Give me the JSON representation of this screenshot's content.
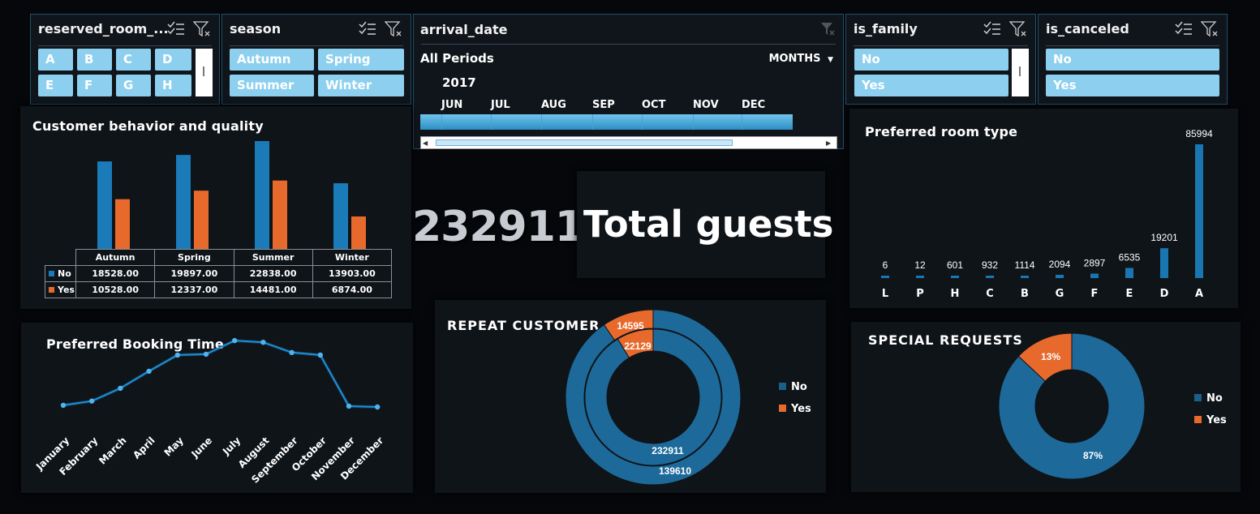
{
  "colors": {
    "no": "#1a7bb8",
    "yes": "#e8692c",
    "slicer_btn": "#8ccfee",
    "line": "#1e8fd6"
  },
  "slicers": {
    "reserved_room": {
      "title": "reserved_room_...",
      "options": [
        "A",
        "B",
        "C",
        "D",
        "E",
        "F",
        "G",
        "H"
      ]
    },
    "season": {
      "title": "season",
      "options": [
        "Autumn",
        "Spring",
        "Summer",
        "Winter"
      ]
    },
    "is_family": {
      "title": "is_family",
      "options": [
        "No",
        "Yes"
      ]
    },
    "is_canceled": {
      "title": "is_canceled",
      "options": [
        "No",
        "Yes"
      ]
    }
  },
  "timeline": {
    "title": "arrival_date",
    "period": "All Periods",
    "granularity": "MONTHS",
    "year": "2017",
    "months": [
      "JUN",
      "JUL",
      "AUG",
      "SEP",
      "OCT",
      "NOV",
      "DEC"
    ]
  },
  "kpi": {
    "value": "232911",
    "label": "Total guests"
  },
  "chart_data": [
    {
      "type": "bar",
      "title": "Customer behavior and quality",
      "categories": [
        "Autumn",
        "Spring",
        "Summer",
        "Winter"
      ],
      "series": [
        {
          "name": "No",
          "values": [
            18528,
            19897,
            22838,
            13903
          ]
        },
        {
          "name": "Yes",
          "values": [
            10528,
            12337,
            14481,
            6874
          ]
        }
      ],
      "table": {
        "No": [
          "18528.00",
          "19897.00",
          "22838.00",
          "13903.00"
        ],
        "Yes": [
          "10528.00",
          "12337.00",
          "14481.00",
          "6874.00"
        ]
      }
    },
    {
      "type": "bar",
      "title": "Preferred room type",
      "categories": [
        "L",
        "P",
        "H",
        "C",
        "B",
        "G",
        "F",
        "E",
        "D",
        "A"
      ],
      "values": [
        6,
        12,
        601,
        932,
        1114,
        2094,
        2897,
        6535,
        19201,
        85994
      ]
    },
    {
      "type": "line",
      "title": "Preferred Booking Time",
      "categories": [
        "January",
        "February",
        "March",
        "April",
        "May",
        "June",
        "July",
        "August",
        "September",
        "October",
        "November",
        "December"
      ],
      "values": [
        0.22,
        0.27,
        0.42,
        0.62,
        0.81,
        0.82,
        0.98,
        0.96,
        0.84,
        0.81,
        0.21,
        0.2
      ]
    },
    {
      "type": "pie",
      "title": "REPEAT CUSTOMER",
      "legend": [
        "No",
        "Yes"
      ],
      "rings": [
        {
          "No": 139610,
          "Yes": 14595
        },
        {
          "No": 232911,
          "Yes": 22129
        }
      ]
    },
    {
      "type": "pie",
      "title": "SPECIAL REQUESTS",
      "legend": [
        "No",
        "Yes"
      ],
      "slices": [
        {
          "name": "No",
          "label": "87%",
          "value": 87
        },
        {
          "name": "Yes",
          "label": "13%",
          "value": 13
        }
      ]
    }
  ]
}
